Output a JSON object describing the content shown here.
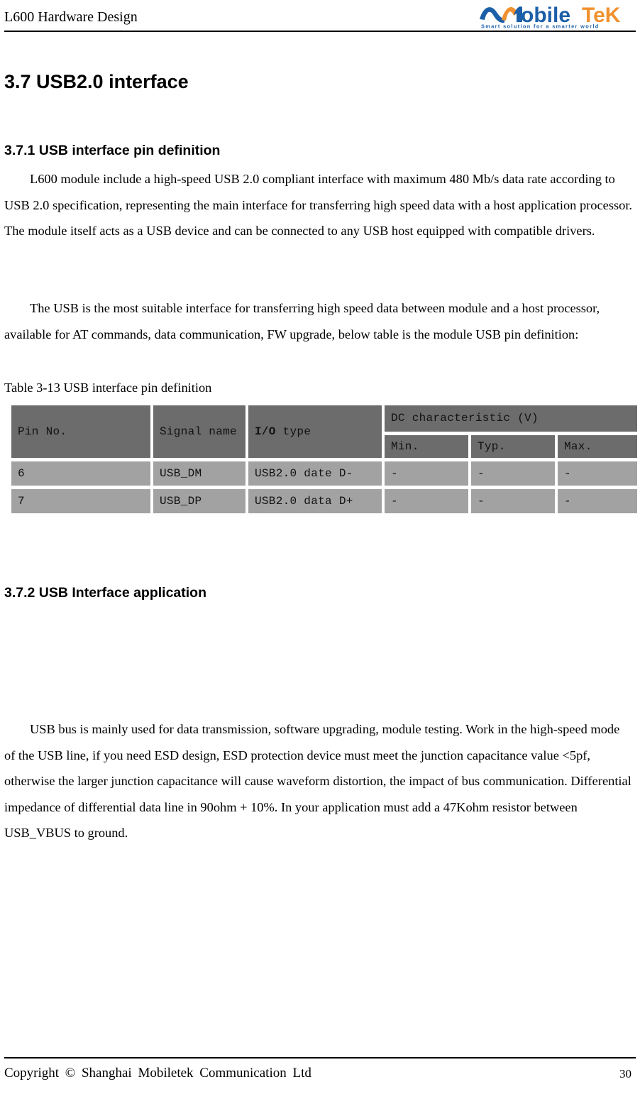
{
  "header": {
    "title": "L600 Hardware Design",
    "logo": {
      "name_part_1": "obile",
      "name_part_2": "TeK",
      "tagline": "Smart solution for a smarter world",
      "color_blue": "#1b5fa8",
      "color_orange": "#f0912f"
    }
  },
  "main": {
    "section_title": "3.7 USB2.0 interface",
    "subsection_1_title": "3.7.1 USB interface pin definition",
    "paragraph_1": "L600 module include a high-speed USB 2.0 compliant interface with maximum 480 Mb/s data rate according to USB 2.0 specification, representing the main interface for transferring high speed data with a host application processor. The module itself acts as a USB device and can be connected to any USB host equipped with compatible drivers.",
    "paragraph_2": "The USB is the most suitable interface for transferring high speed data between module and a host processor, available for AT commands, data communication, FW upgrade, below table is the module USB pin definition:",
    "table_caption": "Table 3-13 USB interface pin definition",
    "subsection_2_title": "3.7.2 USB Interface application",
    "paragraph_3": "USB bus is mainly used for data transmission, software upgrading, module testing. Work in the high-speed mode of the USB line, if you need ESD design, ESD protection device must meet the junction capacitance value <5pf, otherwise the larger junction capacitance will cause waveform distortion, the impact of bus communication. Differential impedance of differential data line in 90ohm + 10%. In your application must add a 47Kohm resistor between USB_VBUS to ground."
  },
  "pin_table": {
    "headers": {
      "pin_no": "Pin No.",
      "signal_name": "Signal name",
      "io_type_bold": "I/O",
      "io_type_rest": " type",
      "dc_group": "DC characteristic (V)",
      "min": "Min.",
      "typ": "Typ.",
      "max": "Max."
    },
    "rows": [
      {
        "pin_no": "6",
        "signal_name": "USB_DM",
        "io_type": "USB2.0 date D-",
        "min": "-",
        "typ": "-",
        "max": "-"
      },
      {
        "pin_no": "7",
        "signal_name": "USB_DP",
        "io_type": "USB2.0 data D+",
        "min": "-",
        "typ": "-",
        "max": "-"
      }
    ],
    "colors": {
      "header_bg": "#6c6c6c",
      "cell_bg": "#a2a2a2"
    }
  },
  "footer": {
    "copyright": "Copyright © Shanghai Mobiletek Communication Ltd",
    "page_number": "30"
  }
}
